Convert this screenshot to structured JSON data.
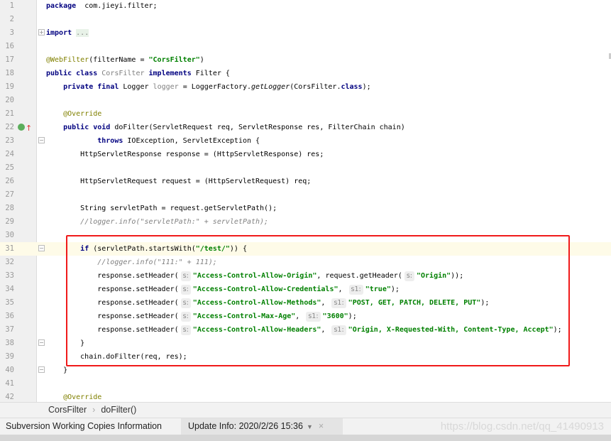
{
  "editor": {
    "current_line": 31,
    "lines": [
      {
        "n": "1",
        "t": [
          [
            "kw",
            "package"
          ],
          [
            "",
            "  com.jieyi.filter;"
          ]
        ]
      },
      {
        "n": "2",
        "t": []
      },
      {
        "n": "3",
        "fold": "+",
        "t": [
          [
            "kw",
            "import"
          ],
          [
            "",
            " "
          ],
          [
            "fold",
            "..."
          ]
        ]
      },
      {
        "n": "16",
        "t": []
      },
      {
        "n": "17",
        "t": [
          [
            "ann",
            "@WebFilter"
          ],
          [
            "",
            "(filterName = "
          ],
          [
            "str",
            "\"CorsFilter\""
          ],
          [
            "",
            ")"
          ]
        ]
      },
      {
        "n": "18",
        "t": [
          [
            "kw",
            "public class "
          ],
          [
            "unused",
            "CorsFilter"
          ],
          [
            "kw",
            " implements "
          ],
          [
            "",
            "Filter {"
          ]
        ]
      },
      {
        "n": "19",
        "t": [
          [
            "",
            "    "
          ],
          [
            "kw",
            "private final "
          ],
          [
            "",
            "Logger "
          ],
          [
            "unused",
            "logger"
          ],
          [
            "",
            " = LoggerFactory."
          ],
          [
            "it",
            "getLogger"
          ],
          [
            "",
            "(CorsFilter."
          ],
          [
            "kw",
            "class"
          ],
          [
            "",
            ");"
          ]
        ]
      },
      {
        "n": "20",
        "t": []
      },
      {
        "n": "21",
        "t": [
          [
            "",
            "    "
          ],
          [
            "ann",
            "@Override"
          ]
        ]
      },
      {
        "n": "22",
        "icon": true,
        "t": [
          [
            "",
            "    "
          ],
          [
            "kw",
            "public void "
          ],
          [
            "",
            "doFilter(ServletRequest req, ServletResponse res, FilterChain chain)"
          ]
        ]
      },
      {
        "n": "23",
        "fold": "-",
        "t": [
          [
            "",
            "            "
          ],
          [
            "kw",
            "throws "
          ],
          [
            "",
            "IOException, ServletException {"
          ]
        ]
      },
      {
        "n": "24",
        "t": [
          [
            "",
            "        HttpServletResponse response = (HttpServletResponse) res;"
          ]
        ]
      },
      {
        "n": "25",
        "t": []
      },
      {
        "n": "26",
        "t": [
          [
            "",
            "        HttpServletRequest request = (HttpServletRequest) req;"
          ]
        ]
      },
      {
        "n": "27",
        "t": []
      },
      {
        "n": "28",
        "t": [
          [
            "",
            "        String servletPath = request.getServletPath();"
          ]
        ]
      },
      {
        "n": "29",
        "t": [
          [
            "",
            "        "
          ],
          [
            "cmt",
            "//logger.info(\"servletPath:\" + servletPath);"
          ]
        ]
      },
      {
        "n": "30",
        "t": []
      },
      {
        "n": "31",
        "fold": "-",
        "t": [
          [
            "",
            "        "
          ],
          [
            "kw",
            "if"
          ],
          [
            "",
            " (servletPath.startsWith("
          ],
          [
            "str",
            "\"/test/\""
          ],
          [
            "",
            ")) {"
          ]
        ]
      },
      {
        "n": "32",
        "t": [
          [
            "",
            "            "
          ],
          [
            "cmt",
            "//logger.info(\"111:\" + 111);"
          ]
        ]
      },
      {
        "n": "33",
        "t": [
          [
            "",
            "            response.setHeader("
          ],
          [
            "hint",
            "s:"
          ],
          [
            "str",
            "\"Access-Control-Allow-Origin\""
          ],
          [
            "",
            ", request.getHeader("
          ],
          [
            "hint",
            "s:"
          ],
          [
            "str",
            "\"Origin\""
          ],
          [
            "",
            "));"
          ]
        ]
      },
      {
        "n": "34",
        "t": [
          [
            "",
            "            response.setHeader("
          ],
          [
            "hint",
            "s:"
          ],
          [
            "str",
            "\"Access-Control-Allow-Credentials\""
          ],
          [
            "",
            ", "
          ],
          [
            "hint",
            "s1:"
          ],
          [
            "str",
            "\"true\""
          ],
          [
            "",
            ");"
          ]
        ]
      },
      {
        "n": "35",
        "t": [
          [
            "",
            "            response.setHeader("
          ],
          [
            "hint",
            "s:"
          ],
          [
            "str",
            "\"Access-Control-Allow-Methods\""
          ],
          [
            "",
            ", "
          ],
          [
            "hint",
            "s1:"
          ],
          [
            "str",
            "\"POST, GET, PATCH, DELETE, PUT\""
          ],
          [
            "",
            ");"
          ]
        ]
      },
      {
        "n": "36",
        "t": [
          [
            "",
            "            response.setHeader("
          ],
          [
            "hint",
            "s:"
          ],
          [
            "str",
            "\"Access-Control-Max-Age\""
          ],
          [
            "",
            ", "
          ],
          [
            "hint",
            "s1:"
          ],
          [
            "str",
            "\"3600\""
          ],
          [
            "",
            ");"
          ]
        ]
      },
      {
        "n": "37",
        "t": [
          [
            "",
            "            response.setHeader("
          ],
          [
            "hint",
            "s:"
          ],
          [
            "str",
            "\"Access-Control-Allow-Headers\""
          ],
          [
            "",
            ", "
          ],
          [
            "hint",
            "s1:"
          ],
          [
            "str",
            "\"Origin, X-Requested-With, Content-Type, Accept\""
          ],
          [
            "",
            ");"
          ]
        ]
      },
      {
        "n": "38",
        "fold": "-",
        "t": [
          [
            "",
            "        }"
          ]
        ]
      },
      {
        "n": "39",
        "t": [
          [
            "",
            "        chain.doFilter(req, res);"
          ]
        ]
      },
      {
        "n": "40",
        "fold": "-",
        "t": [
          [
            "",
            "    }"
          ]
        ]
      },
      {
        "n": "41",
        "t": []
      },
      {
        "n": "42",
        "t": [
          [
            "",
            "    "
          ],
          [
            "ann",
            "@Override"
          ]
        ]
      }
    ]
  },
  "breadcrumb": {
    "items": [
      "CorsFilter",
      "doFilter()"
    ],
    "separator": "›"
  },
  "tool_tabs": {
    "tab1": "Subversion Working Copies Information",
    "tab2": "Update Info: 2020/2/26 15:36",
    "dropdown_icon": "▼",
    "close_icon": "×"
  },
  "watermark": "https://blog.csdn.net/qq_41490913",
  "colors": {
    "keyword": "#000080",
    "string": "#008000",
    "annotation": "#808000",
    "comment": "#808080",
    "highlight_box": "#f01a1a",
    "current_line": "#fefbe8"
  }
}
